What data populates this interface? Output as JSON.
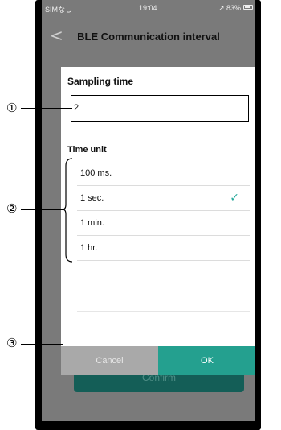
{
  "status_bar": {
    "carrier": "SIMなし",
    "time": "19:04",
    "battery": "↗ 83%"
  },
  "nav": {
    "back_glyph": "<",
    "title": "BLE Communication interval"
  },
  "background_button": {
    "label": "Confirm"
  },
  "dialog": {
    "sampling_label": "Sampling time",
    "sampling_value": "2",
    "time_unit_label": "Time unit",
    "options": [
      {
        "label": "100 ms.",
        "selected": false
      },
      {
        "label": "1 sec.",
        "selected": true
      },
      {
        "label": "1 min.",
        "selected": false
      },
      {
        "label": "1 hr.",
        "selected": false
      }
    ],
    "check_glyph": "✓",
    "cancel_label": "Cancel",
    "ok_label": "OK"
  },
  "callouts": {
    "one": "①",
    "two": "②",
    "three": "③"
  },
  "colors": {
    "accent": "#24a08f",
    "check": "#25a89a",
    "cancel": "#a9a9a9",
    "overlay": "#7a7a7a"
  }
}
